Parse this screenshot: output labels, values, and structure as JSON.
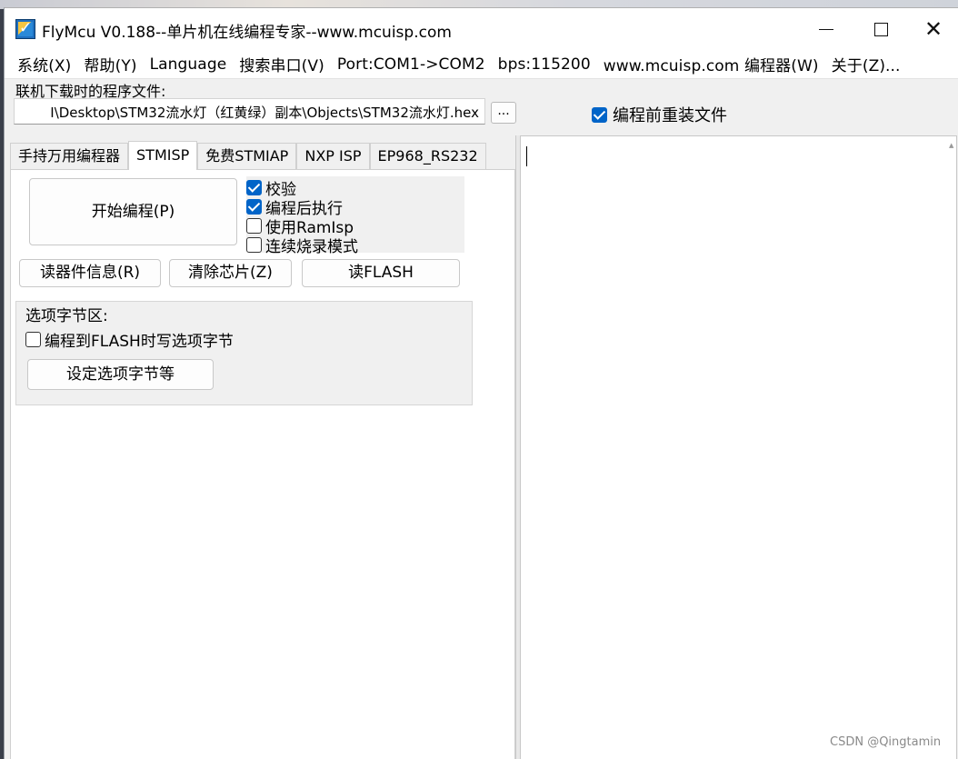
{
  "window": {
    "title": "FlyMcu V0.188--单片机在线编程专家--www.mcuisp.com"
  },
  "menu": [
    "系统(X)",
    "帮助(Y)",
    "Language",
    "搜索串口(V)",
    "Port:COM1->COM2",
    "bps:115200",
    "www.mcuisp.com 编程器(W)",
    "关于(Z)..."
  ],
  "file": {
    "label": "联机下载时的程序文件:",
    "path": "I\\Desktop\\STM32流水灯（红黄绿）副本\\Objects\\STM32流水灯.hex",
    "browse_label": "...",
    "reload_label": "编程前重装文件",
    "reload_checked": true
  },
  "tabs": [
    "手持万用编程器",
    "STMISP",
    "免费STMIAP",
    "NXP ISP",
    "EP968_RS232"
  ],
  "active_tab": "STMISP",
  "stmisp": {
    "program_label": "开始编程(P)",
    "options": [
      {
        "label": "校验",
        "checked": true
      },
      {
        "label": "编程后执行",
        "checked": true
      },
      {
        "label": "使用RamIsp",
        "checked": false
      },
      {
        "label": "连续烧录模式",
        "checked": false
      }
    ],
    "read_info_label": "读器件信息(R)",
    "erase_label": "清除芯片(Z)",
    "read_flash_label": "读FLASH",
    "option_bytes": {
      "title": "选项字节区:",
      "write_label": "编程到FLASH时写选项字节",
      "write_checked": false,
      "set_label": "设定选项字节等"
    }
  },
  "watermark": "CSDN @Qingtamin",
  "colors": {
    "checkbox_accent": "#0064c8",
    "window_bg": "#f0f0f0"
  }
}
